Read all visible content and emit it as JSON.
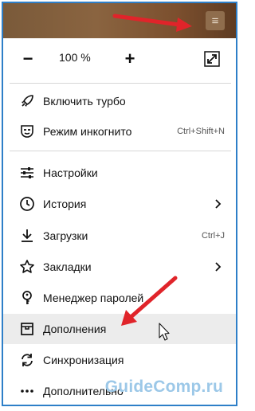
{
  "toolbar": {
    "menu_glyph": "≡"
  },
  "zoom": {
    "minus": "−",
    "value": "100 %",
    "plus": "+"
  },
  "menu": {
    "turbo": "Включить турбо",
    "incognito": "Режим инкогнито",
    "incognito_shortcut": "Ctrl+Shift+N",
    "settings": "Настройки",
    "history": "История",
    "downloads": "Загрузки",
    "downloads_shortcut": "Ctrl+J",
    "bookmarks": "Закладки",
    "passwords": "Менеджер паролей",
    "addons": "Дополнения",
    "sync": "Синхронизация",
    "more": "Дополнительно"
  },
  "watermark": {
    "text": "GuideComp.ru"
  },
  "colors": {
    "frame_border": "#2e7fc8",
    "arrow": "#e0242a",
    "watermark": "#9cc8e8"
  }
}
